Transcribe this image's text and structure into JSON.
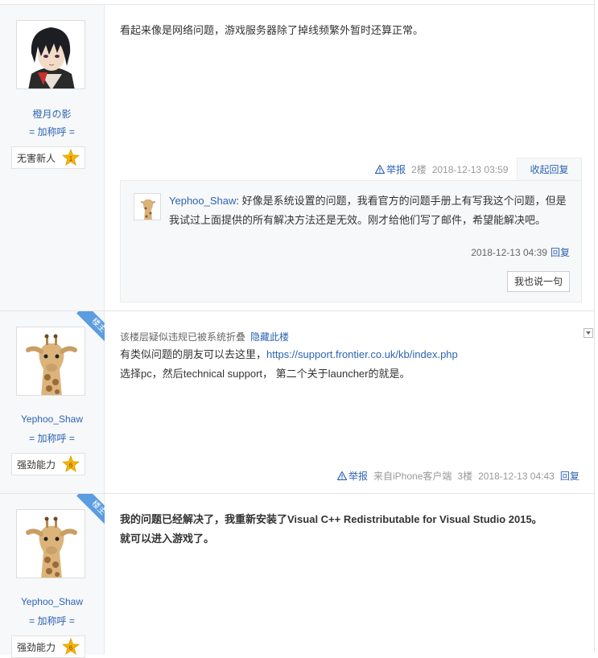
{
  "posts": [
    {
      "user": {
        "name": "橙月の影",
        "call": "= 加称呼 =",
        "badge": "无害新人",
        "level": "1"
      },
      "content": "看起来像是网络问题，游戏服务器除了掉线频繁外暂时还算正常。",
      "meta": {
        "report": "举报",
        "floor": "2楼",
        "time": "2018-12-13 03:59",
        "reply_toggle": "收起回复"
      },
      "lzl": {
        "user": "Yephoo_Shaw",
        "text": "好像是系统设置的问题，我看官方的问题手册上有写我这个问题，但是我试过上面提供的所有解决方法还是无效。刚才给他们写了邮件，希望能解决吧。",
        "time": "2018-12-13 04:39",
        "reply": "回复",
        "say_button": "我也说一句"
      }
    },
    {
      "corner": "楼主",
      "user": {
        "name": "Yephoo_Shaw",
        "call": "= 加称呼 =",
        "badge": "强劲能力",
        "level": "6"
      },
      "fold_notice": "该楼层疑似违规已被系统折叠",
      "fold_link": "隐藏此楼",
      "line1_prefix": "有类似问题的朋友可以去这里，",
      "line1_link": "https://support.frontier.co.uk/kb/index.php",
      "line2": "选择pc，然后technical support，  第二个关于launcher的就是。",
      "meta": {
        "report": "举报",
        "source": "来自iPhone客户端",
        "floor": "3楼",
        "time": "2018-12-13 04:43",
        "reply": "回复"
      }
    },
    {
      "corner": "楼主",
      "user": {
        "name": "Yephoo_Shaw",
        "call": "= 加称呼 =",
        "badge": "强劲能力",
        "level": "6"
      },
      "line1": "我的问题已经解决了，我重新安装了Visual C++ Redistributable for Visual Studio 2015。",
      "line2": "就可以进入游戏了。"
    }
  ],
  "colors": {
    "link": "#2d64b3",
    "corner": "#5a9de0",
    "badge_gold": "#f5b400"
  }
}
